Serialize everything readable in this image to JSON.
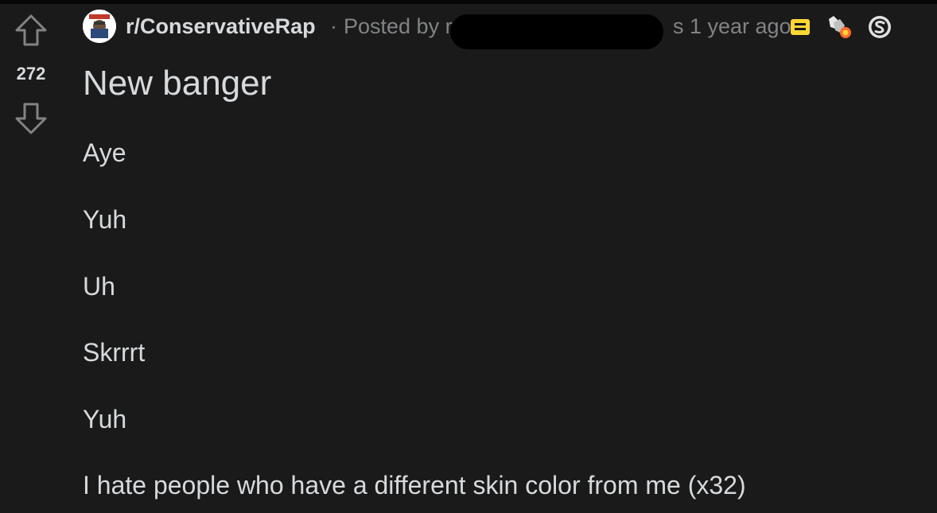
{
  "post": {
    "score": "272",
    "subreddit": "r/ConservativeRap",
    "separator": "·",
    "posted_by_prefix": "Posted by",
    "posted_by_visible": "r",
    "time_fragment": "s 1 year ago",
    "title": "New banger",
    "body_lines": [
      "Aye",
      "Yuh",
      "Uh",
      "Skrrrt",
      "Yuh",
      "I hate people who have a different skin color from me (x32)"
    ]
  },
  "icons": {
    "upvote": "upvote-arrow-icon",
    "downvote": "downvote-arrow-icon",
    "subreddit_avatar": "subreddit-avatar-icon",
    "award_1": "yellow-award-icon",
    "award_2": "wholesome-hands-award-icon",
    "award_3": "silver-award-icon"
  },
  "colors": {
    "background": "#1a1a1b",
    "text": "#d7dadc",
    "muted": "#818384",
    "award_yellow": "#ffd635",
    "award_orange": "#ff6a2c"
  }
}
